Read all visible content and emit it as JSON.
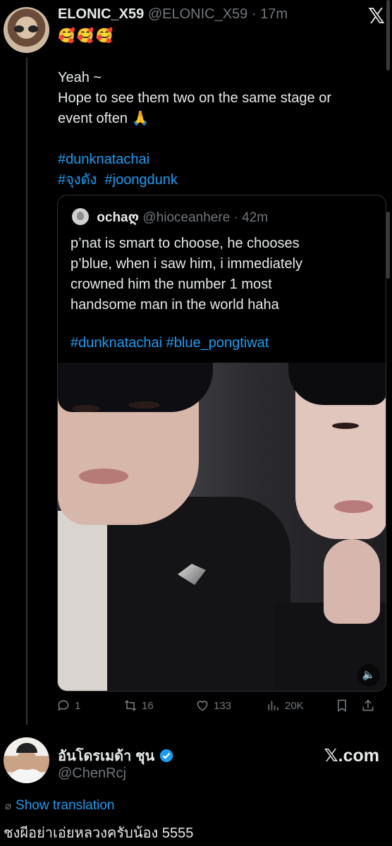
{
  "post": {
    "display_name": "ELONIC_X59",
    "handle_time": "@ELONIC_X59 · 17m",
    "emojis": "🥰🥰🥰",
    "text_line1": "Yeah ~",
    "text_line2": "Hope to see them two on the same stage or",
    "text_line3": "event often 🙏",
    "tag1": "#dunknatachai",
    "tag2": "#จุงดัง",
    "tag3": "#joongdunk"
  },
  "quote": {
    "display_name": "ochaღ",
    "handle_time": "@hioceanhere · 42m",
    "text_line1": "p’nat is smart to choose, he chooses",
    "text_line2": "p’blue, when i saw him, i immediately",
    "text_line3": "crowned him the number 1 most",
    "text_line4": "handsome man in the world haha",
    "tag1": "#dunknatachai",
    "tag2": "#blue_pongtiwat"
  },
  "actions": {
    "replies": "1",
    "reposts": "16",
    "likes": "133",
    "views": "20K"
  },
  "reply": {
    "display_name": "อันโดรเมด้า ชุน",
    "handle": "@ChenRcj",
    "source": "𝕏.com",
    "translate_label": "Show translation",
    "text": "ชงผีอย่าเอ่ยหลวงครับน้อง 5555"
  },
  "colors": {
    "accent": "#1d9bf0",
    "muted": "#71767b",
    "background": "#000000"
  }
}
